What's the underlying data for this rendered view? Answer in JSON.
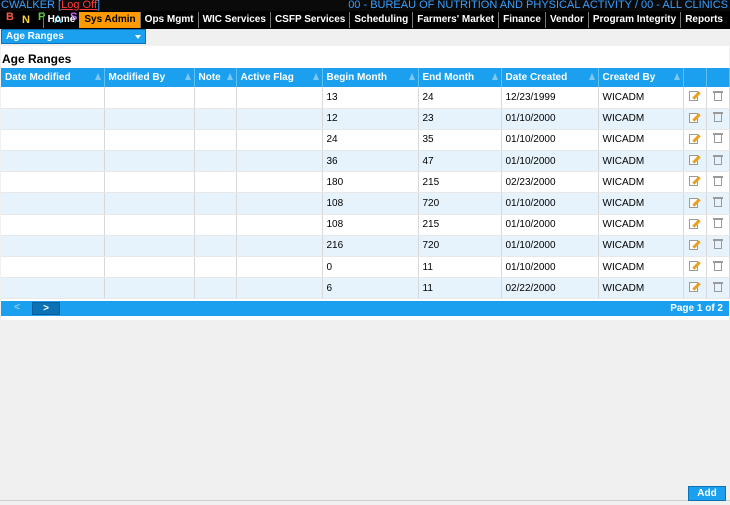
{
  "header": {
    "user": "CWALKER",
    "logoff_label": "Log Off",
    "org": "00 - BUREAU OF NUTRITION AND PHYSICAL ACTIVITY / 00 - ALL CLINICS",
    "logo_text": "BNPAS"
  },
  "nav": {
    "items": [
      "Home",
      "Sys Admin",
      "Ops Mgmt",
      "WIC Services",
      "CSFP Services",
      "Scheduling",
      "Farmers' Market",
      "Finance",
      "Vendor",
      "Program Integrity",
      "Reports"
    ],
    "active": "Sys Admin"
  },
  "dropdown": {
    "selected": "Age Ranges"
  },
  "page_title": "Age Ranges",
  "table": {
    "columns": [
      "Date Modified",
      "Modified By",
      "Note",
      "Active Flag",
      "Begin Month",
      "End Month",
      "Date Created",
      "Created By"
    ],
    "rows": [
      [
        "",
        "",
        "",
        "",
        "13",
        "24",
        "12/23/1999",
        "WICADM"
      ],
      [
        "",
        "",
        "",
        "",
        "12",
        "23",
        "01/10/2000",
        "WICADM"
      ],
      [
        "",
        "",
        "",
        "",
        "24",
        "35",
        "01/10/2000",
        "WICADM"
      ],
      [
        "",
        "",
        "",
        "",
        "36",
        "47",
        "01/10/2000",
        "WICADM"
      ],
      [
        "",
        "",
        "",
        "",
        "180",
        "215",
        "02/23/2000",
        "WICADM"
      ],
      [
        "",
        "",
        "",
        "",
        "108",
        "720",
        "01/10/2000",
        "WICADM"
      ],
      [
        "",
        "",
        "",
        "",
        "108",
        "215",
        "01/10/2000",
        "WICADM"
      ],
      [
        "",
        "",
        "",
        "",
        "216",
        "720",
        "01/10/2000",
        "WICADM"
      ],
      [
        "",
        "",
        "",
        "",
        "0",
        "11",
        "01/10/2000",
        "WICADM"
      ],
      [
        "",
        "",
        "",
        "",
        "6",
        "11",
        "02/22/2000",
        "WICADM"
      ]
    ]
  },
  "pager": {
    "prev_label": "<",
    "next_label": ">",
    "page_info": "Page 1 of 2"
  },
  "add_label": "Add",
  "colors": {
    "accent": "#1aa0ee",
    "active_tab": "#ff9a00",
    "row_alt": "#e6f3fc"
  }
}
